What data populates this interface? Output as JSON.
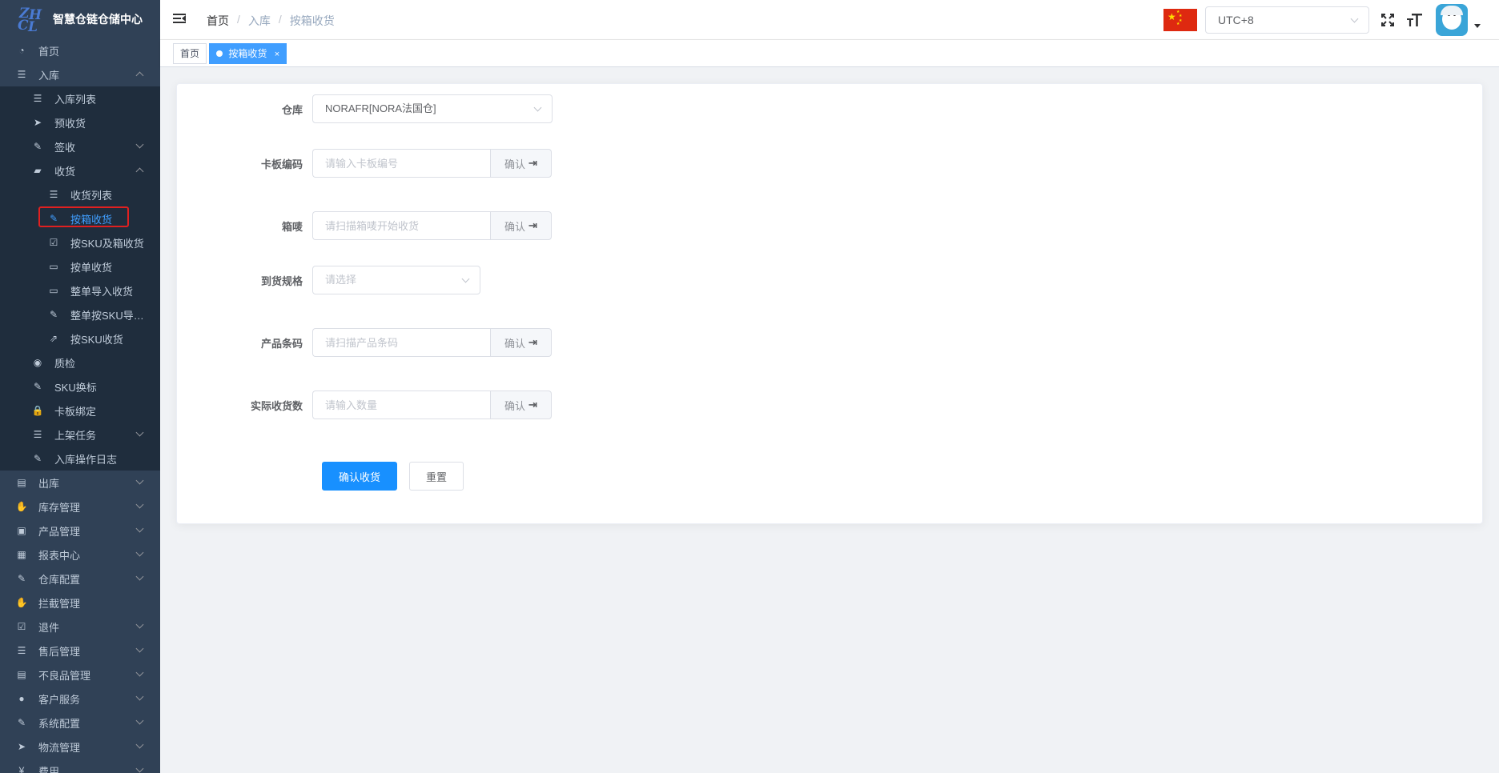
{
  "app": {
    "logo_text": "ZHCL",
    "title": "智慧仓链仓储中心"
  },
  "sidebar": {
    "items": [
      {
        "label": "首页",
        "icon": "dashboard-icon",
        "level": 1
      },
      {
        "label": "入库",
        "icon": "list-icon",
        "level": 1,
        "expanded": true
      },
      {
        "label": "入库列表",
        "icon": "list-icon",
        "level": 2
      },
      {
        "label": "预收货",
        "icon": "send-icon",
        "level": 2
      },
      {
        "label": "签收",
        "icon": "edit-icon",
        "level": 2,
        "collapsed": true
      },
      {
        "label": "收货",
        "icon": "clapperboard-icon",
        "level": 2,
        "expanded": true
      },
      {
        "label": "收货列表",
        "icon": "list-icon",
        "level": 3
      },
      {
        "label": "按箱收货",
        "icon": "edit-icon",
        "level": 3,
        "active": true
      },
      {
        "label": "按SKU及箱收货",
        "icon": "checkbox-icon",
        "level": 3
      },
      {
        "label": "按单收货",
        "icon": "monitor-icon",
        "level": 3
      },
      {
        "label": "整单导入收货",
        "icon": "rectangle-icon",
        "level": 3
      },
      {
        "label": "整单按SKU导入...",
        "icon": "edit-icon",
        "level": 3
      },
      {
        "label": "按SKU收货",
        "icon": "external-link-icon",
        "level": 3
      },
      {
        "label": "质检",
        "icon": "eye-icon",
        "level": 2
      },
      {
        "label": "SKU换标",
        "icon": "edit-icon",
        "level": 2
      },
      {
        "label": "卡板绑定",
        "icon": "lock-icon",
        "level": 2
      },
      {
        "label": "上架任务",
        "icon": "list-icon",
        "level": 2,
        "collapsed": true
      },
      {
        "label": "入库操作日志",
        "icon": "edit-icon",
        "level": 2
      },
      {
        "label": "出库",
        "icon": "printer-icon",
        "level": 1,
        "collapsed": true
      },
      {
        "label": "库存管理",
        "icon": "hand-icon",
        "level": 1,
        "collapsed": true
      },
      {
        "label": "产品管理",
        "icon": "briefcase-icon",
        "level": 1,
        "collapsed": true
      },
      {
        "label": "报表中心",
        "icon": "chart-box-icon",
        "level": 1,
        "collapsed": true
      },
      {
        "label": "仓库配置",
        "icon": "edit-icon",
        "level": 1,
        "collapsed": true
      },
      {
        "label": "拦截管理",
        "icon": "hand-icon",
        "level": 1
      },
      {
        "label": "退件",
        "icon": "checkbox-icon",
        "level": 1,
        "collapsed": true
      },
      {
        "label": "售后管理",
        "icon": "list-icon",
        "level": 1,
        "collapsed": true
      },
      {
        "label": "不良品管理",
        "icon": "document-icon",
        "level": 1,
        "collapsed": true
      },
      {
        "label": "客户服务",
        "icon": "user-icon",
        "level": 1,
        "collapsed": true
      },
      {
        "label": "系统配置",
        "icon": "edit-icon",
        "level": 1,
        "collapsed": true
      },
      {
        "label": "物流管理",
        "icon": "send-icon",
        "level": 1,
        "collapsed": true
      },
      {
        "label": "费用",
        "icon": "yen-icon",
        "level": 1,
        "collapsed": true
      }
    ]
  },
  "header": {
    "breadcrumb": [
      "首页",
      "入库",
      "按箱收货"
    ],
    "timezone": "UTC+8",
    "flag": "china-flag-icon"
  },
  "tags": {
    "home": "首页",
    "active": "按箱收货",
    "close": "×"
  },
  "form": {
    "warehouse": {
      "label": "仓库",
      "value": "NORAFR[NORA法国仓]"
    },
    "pallet": {
      "label": "卡板编码",
      "placeholder": "请输入卡板编号",
      "button": "确认"
    },
    "box": {
      "label": "箱唛",
      "placeholder": "请扫描箱唛开始收货",
      "button": "确认"
    },
    "spec": {
      "label": "到货规格",
      "placeholder": "请选择"
    },
    "barcode": {
      "label": "产品条码",
      "placeholder": "请扫描产品条码",
      "button": "确认"
    },
    "quantity": {
      "label": "实际收货数",
      "placeholder": "请输入数量",
      "button": "确认"
    },
    "submit": "确认收货",
    "reset": "重置"
  },
  "colors": {
    "sidebar_bg": "#304156",
    "submenu_bg": "#1f2d3d",
    "primary": "#1890ff",
    "active_text": "#409eff",
    "highlight_border": "#e02020"
  }
}
